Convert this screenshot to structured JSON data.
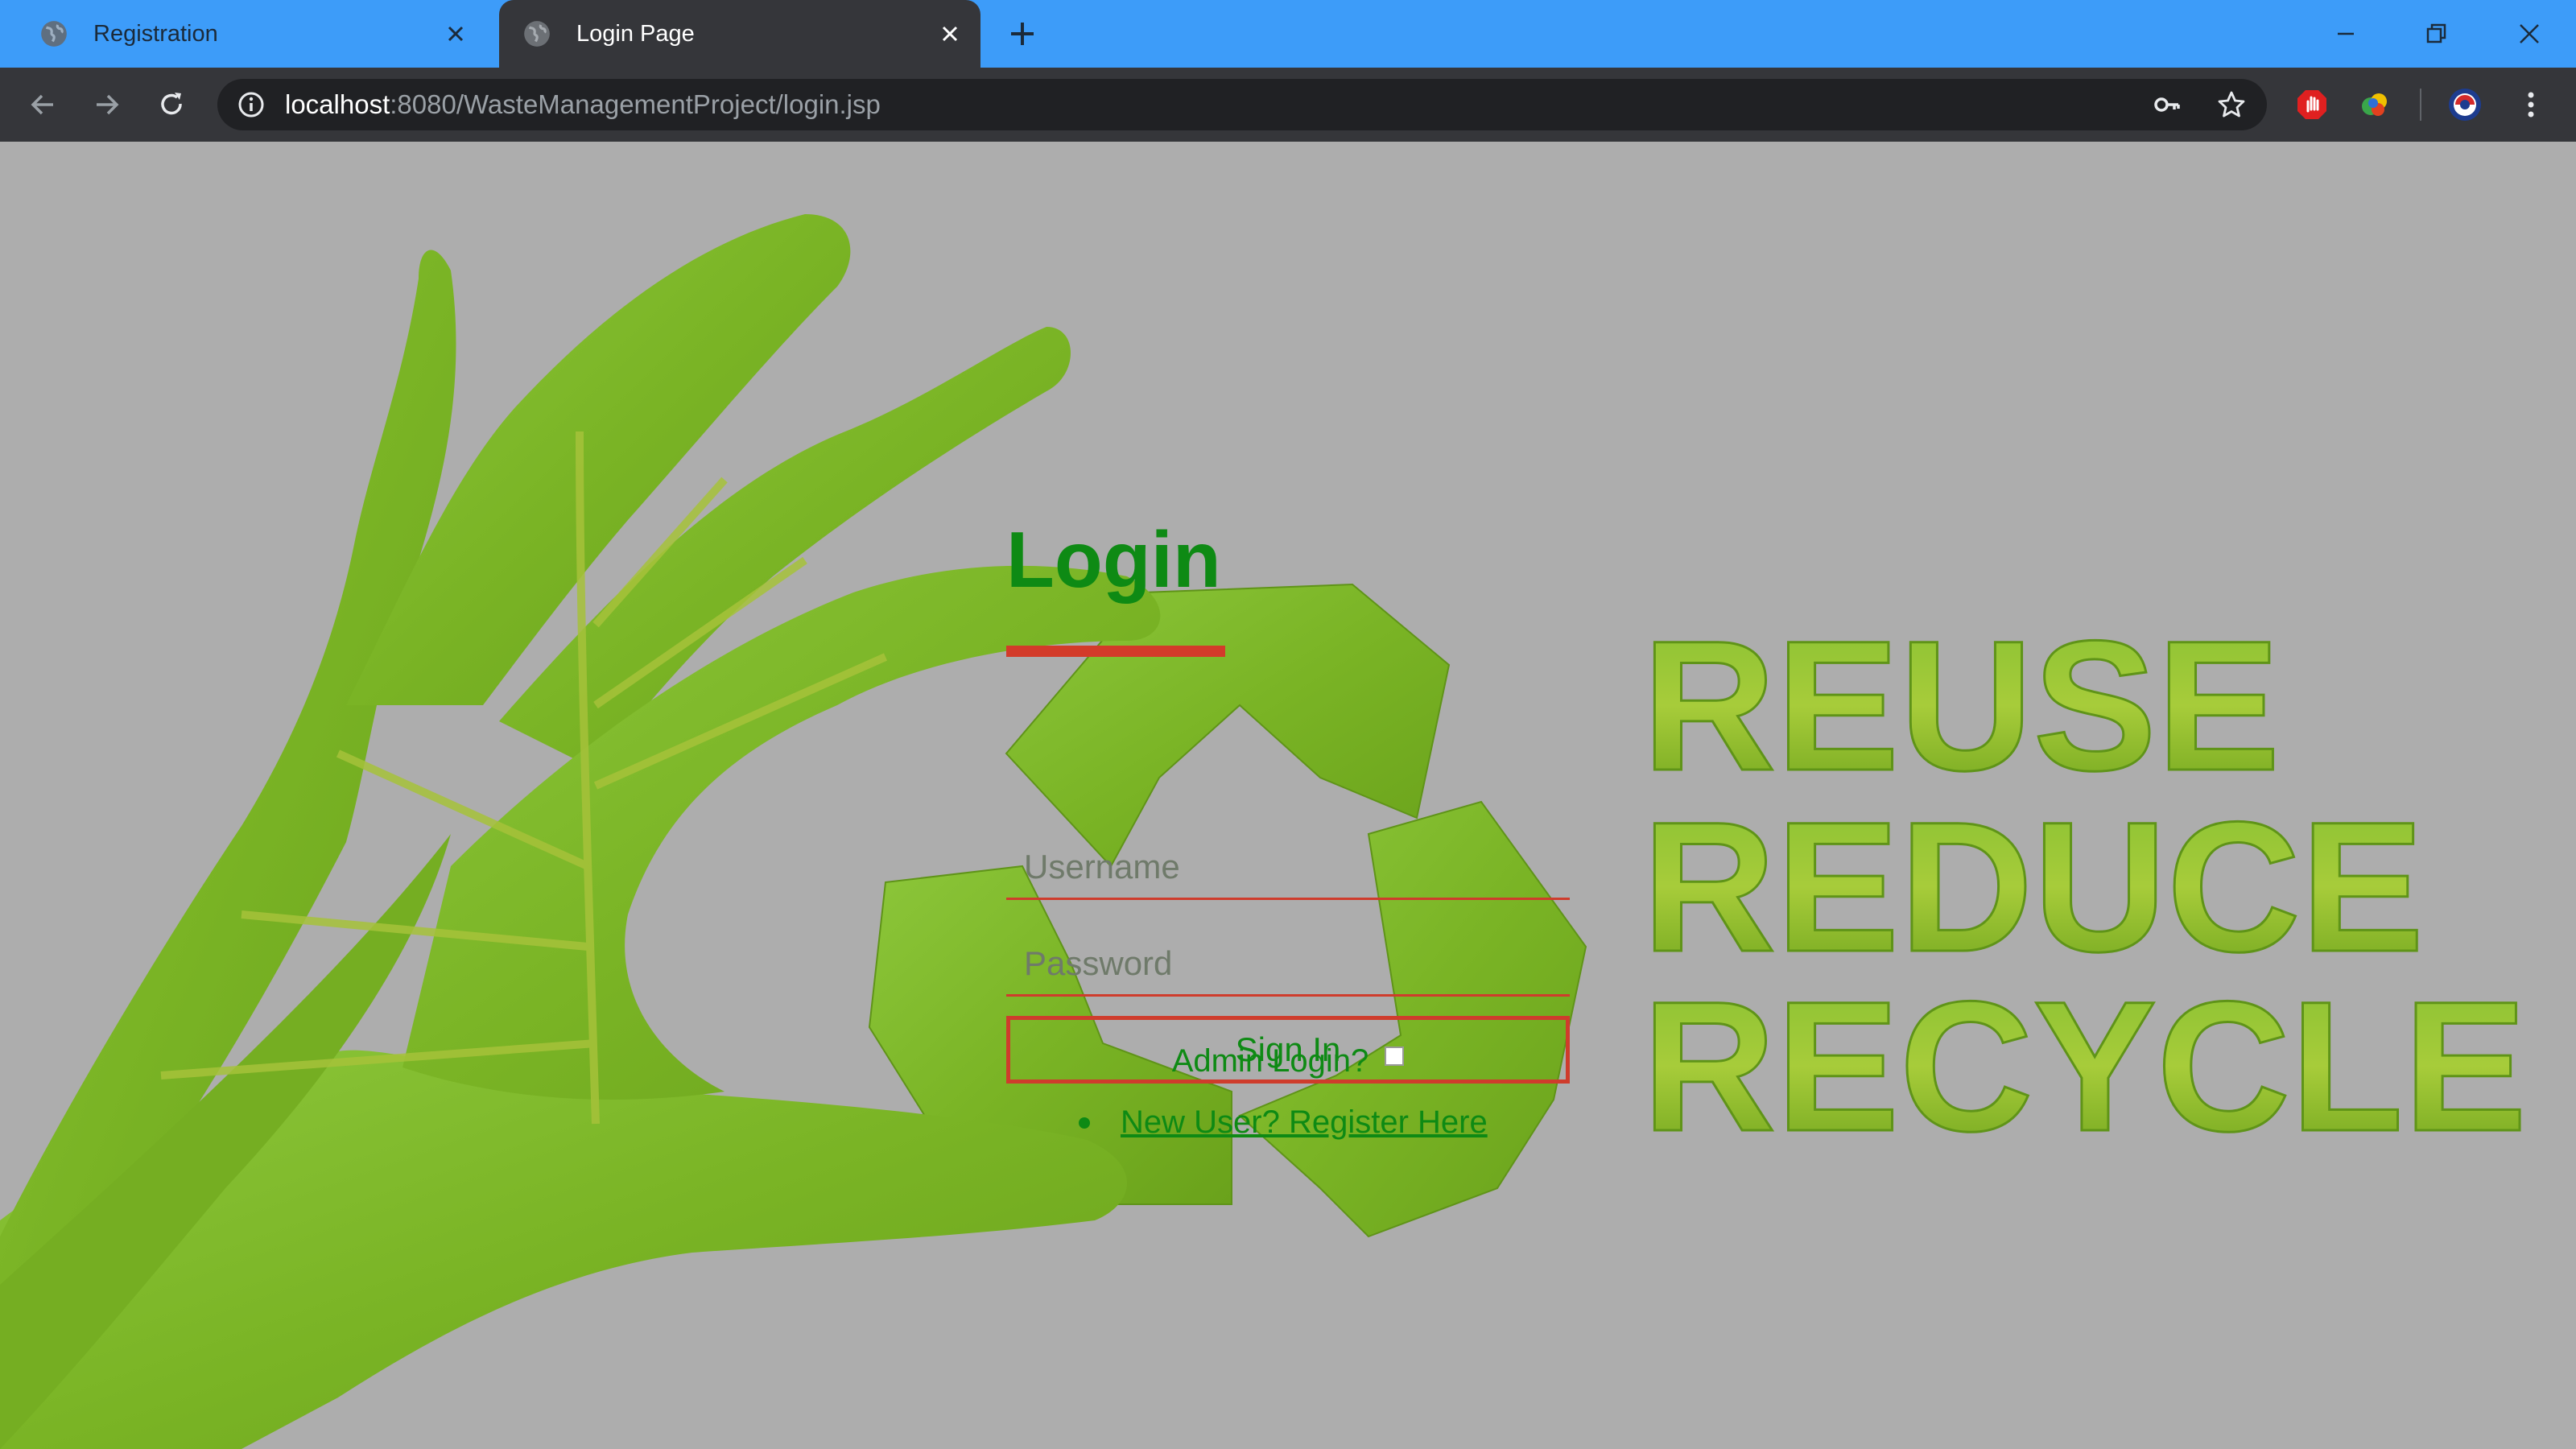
{
  "browser": {
    "tabs": [
      {
        "title": "Registration",
        "active": false
      },
      {
        "title": "Login Page",
        "active": true
      }
    ],
    "url_host": "localhost",
    "url_rest": ":8080/WasteManagementProject/login.jsp",
    "tabbar_color": "#3d9cf9",
    "toolbar_color": "#35363a"
  },
  "login": {
    "heading": "Login",
    "username_placeholder": "Username",
    "password_placeholder": "Password",
    "admin_label": "Admin Login?",
    "admin_checked": false,
    "signin_label": "Sign In",
    "register_link": "New User? Register Here"
  },
  "background": {
    "words": [
      "REUSE",
      "REDUCE",
      "RECYCLE"
    ],
    "accent_green": "#0e8a14",
    "accent_red": "#cf3c2c",
    "leaf_green": "#7bb526"
  }
}
